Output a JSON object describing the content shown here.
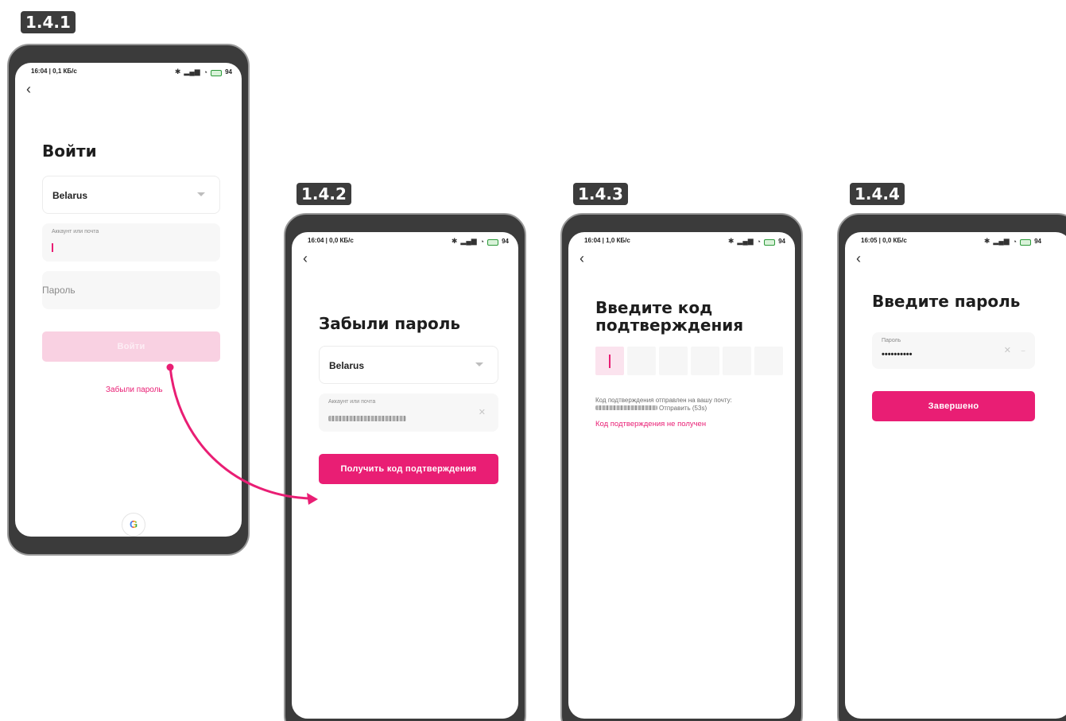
{
  "accent_color": "#e91e74",
  "steps": [
    {
      "label": "1.4.1",
      "status_time": "16:04 | 0,1 КБ/с",
      "battery": "94",
      "title": "Войти",
      "region": "Belarus",
      "account_label": "Аккаунт или почта",
      "password_placeholder": "Пароль",
      "login_button": "Войти",
      "forgot_link": "Забыли пароль",
      "google_icon": "G"
    },
    {
      "label": "1.4.2",
      "status_time": "16:04 | 0,0 КБ/с",
      "battery": "94",
      "title": "Забыли пароль",
      "region": "Belarus",
      "account_label": "Аккаунт или почта",
      "get_code_button": "Получить код подтверждения"
    },
    {
      "label": "1.4.3",
      "status_time": "16:04 | 1,0 КБ/с",
      "battery": "94",
      "title_line1": "Введите код",
      "title_line2": "подтверждения",
      "sent_text": "Код подтверждения отправлен на вашу почту:",
      "resend_text": "Отправить (53s)",
      "not_received_link": "Код подтверждения не получен"
    },
    {
      "label": "1.4.4",
      "status_time": "16:05 | 0,0 КБ/с",
      "battery": "94",
      "title": "Введите пароль",
      "password_label": "Пароль",
      "password_dots": "••••••••••",
      "done_button": "Завершено"
    }
  ]
}
